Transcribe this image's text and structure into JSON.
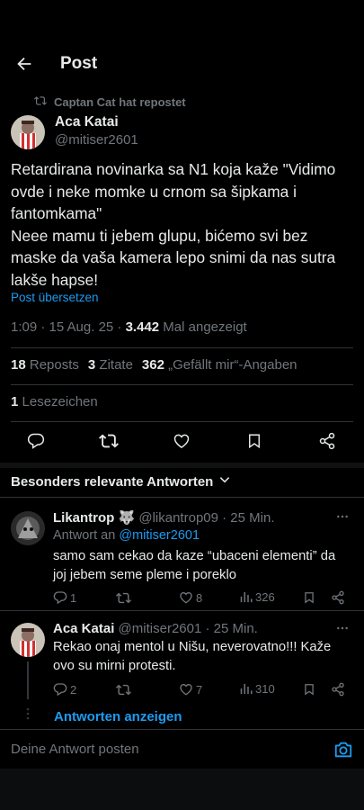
{
  "header": {
    "title": "Post",
    "back_icon": "arrow-left-icon"
  },
  "repost": {
    "text": "Captan Cat hat repostet",
    "icon": "repost-icon"
  },
  "post": {
    "author_name": "Aca Katai",
    "author_handle": "@mitiser2601",
    "text": "Retardirana novinarka sa N1 koja kaže \"Vidimo ovde i neke momke u crnom sa šipkama i fantomkama\"\nNeee mamu ti jebem glupu, bićemo svi bez maske da vaša kamera lepo snimi da nas sutra lakše hapse!",
    "translate": "Post übersetzen",
    "time": "1:09 · 15 Aug. 25 · ",
    "views_count": "3.442",
    "views_label": " Mal angezeigt",
    "reposts_count": "18",
    "reposts_label": "Reposts",
    "quotes_count": "3",
    "quotes_label": "Zitate",
    "likes_count": "362",
    "likes_label": "„Gefällt mir“-Angaben",
    "bookmarks_count": "1",
    "bookmarks_label": "Lesezeichen"
  },
  "relevant": {
    "label": "Besonders relevante Antworten"
  },
  "replies": [
    {
      "name": "Likantrop 🐺",
      "handle": "@likantrop09 · 25 Min.",
      "reply_to_prefix": "Antwort an ",
      "reply_to": "@mitiser2601",
      "text": "samo sam cekao da kaze “ubaceni elementi” da joj jebem seme pleme i poreklo",
      "replies": "1",
      "reposts": "",
      "likes": "8",
      "views": "326"
    },
    {
      "name": "Aca Katai",
      "handle": "@mitiser2601 · 25 Min.",
      "text": "Rekao onaj mentol u Nišu, neverovatno!!! Kaže ovo su mirni protesti.",
      "replies": "2",
      "reposts": "",
      "likes": "7",
      "views": "310"
    }
  ],
  "show_replies": "Antworten anzeigen",
  "composer": {
    "placeholder": "Deine Antwort posten",
    "camera_icon": "camera-icon"
  },
  "colors": {
    "accent": "#1d9bf0",
    "background": "#000000",
    "muted": "#71767b"
  }
}
